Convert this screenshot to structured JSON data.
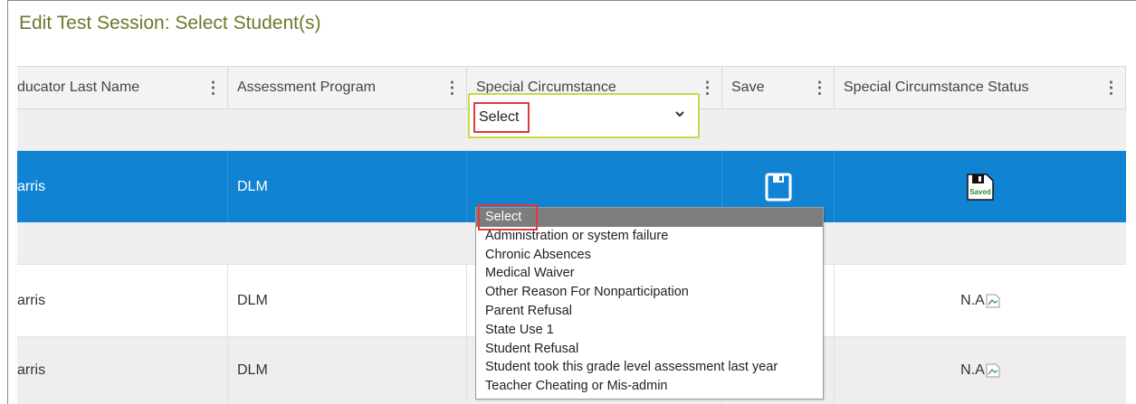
{
  "page_title": "Edit Test Session: Select Student(s)",
  "columns": [
    {
      "label": "ducator Last Name"
    },
    {
      "label": "Assessment Program"
    },
    {
      "label": "Special Circumstance"
    },
    {
      "label": "Save"
    },
    {
      "label": "Special Circumstance Status"
    }
  ],
  "column_menu_glyph": "⋮",
  "selected_row": {
    "educator_last_name": "arris",
    "assessment_program": "DLM",
    "special_circumstance": "Select",
    "status_icon": "saved-disk-icon",
    "status_icon_text": "Saved"
  },
  "rows": [
    {
      "educator_last_name": "arris",
      "assessment_program": "DLM",
      "status": "N.A"
    },
    {
      "educator_last_name": "arris",
      "assessment_program": "DLM",
      "status": "N.A"
    }
  ],
  "dropdown": {
    "options": [
      "Select",
      "Administration or system failure",
      "Chronic Absences",
      "Medical Waiver",
      "Other Reason For Nonparticipation",
      "Parent Refusal",
      "State Use 1",
      "Student Refusal",
      "Student took this grade level assessment last year",
      "Teacher Cheating or Mis-admin"
    ],
    "highlighted": "Select"
  },
  "colors": {
    "title": "#6b7a2a",
    "selected_row": "#1183d3",
    "highlight_box": "#e03a3a",
    "select_border": "#c8d94b",
    "active_option": "#7d7d7d"
  }
}
